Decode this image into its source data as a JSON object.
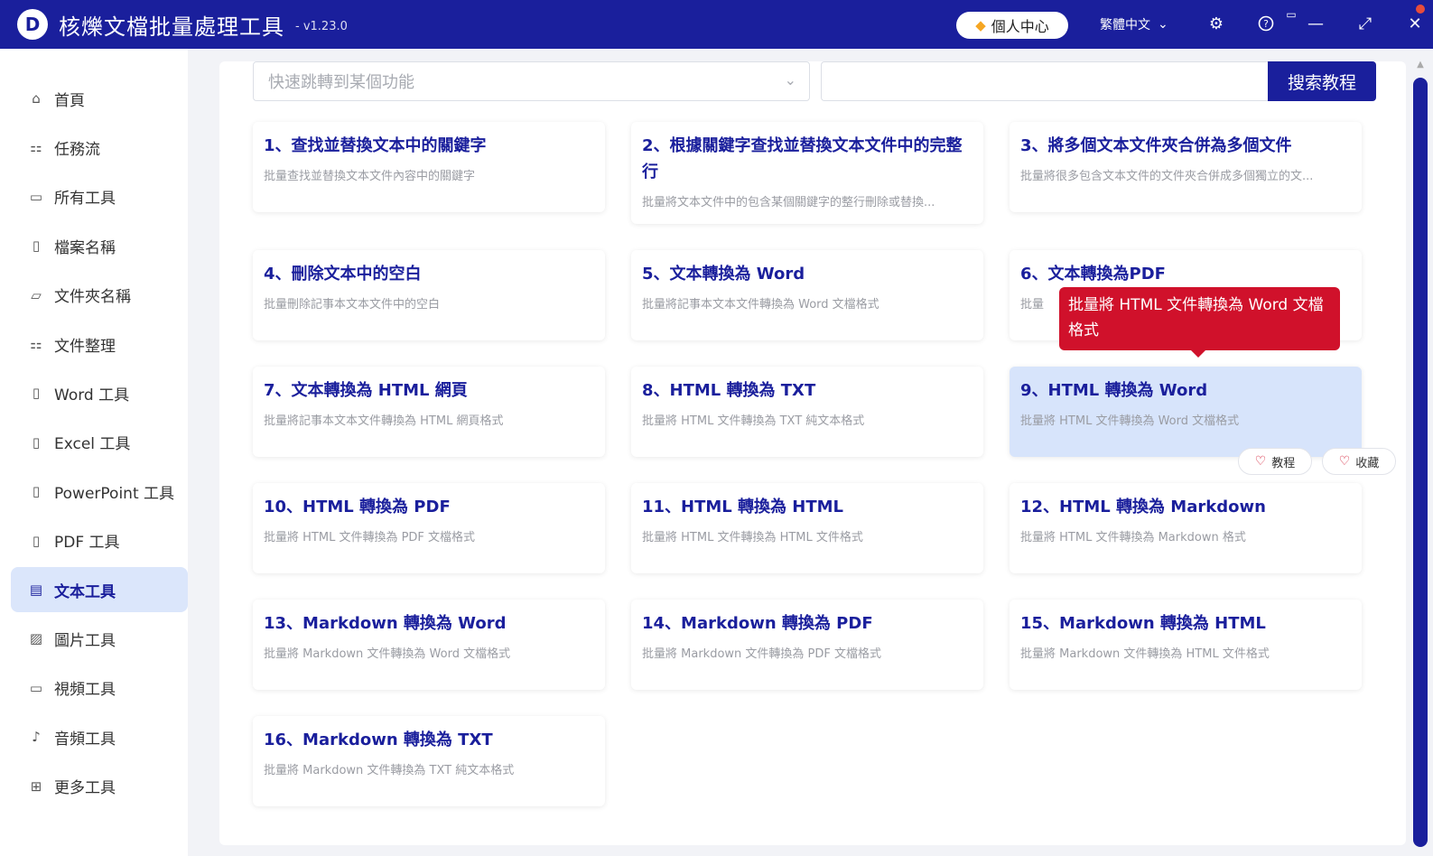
{
  "app": {
    "logo_letter": "D",
    "title": "核爍文檔批量處理工具",
    "version": "- v1.23.0",
    "user_center": "個人中心",
    "language": "繁體中文"
  },
  "sidebar": {
    "items": [
      {
        "label": "首頁",
        "icon": "⌂",
        "icon_name": "home-icon"
      },
      {
        "label": "任務流",
        "icon": "⚏",
        "icon_name": "workflow-icon"
      },
      {
        "label": "所有工具",
        "icon": "▭",
        "icon_name": "monitor-icon"
      },
      {
        "label": "檔案名稱",
        "icon": "▯",
        "icon_name": "file-name-icon"
      },
      {
        "label": "文件夾名稱",
        "icon": "▱",
        "icon_name": "folder-icon"
      },
      {
        "label": "文件整理",
        "icon": "⚏",
        "icon_name": "organize-icon"
      },
      {
        "label": "Word 工具",
        "icon": "▯",
        "icon_name": "word-icon"
      },
      {
        "label": "Excel 工具",
        "icon": "▯",
        "icon_name": "excel-icon"
      },
      {
        "label": "PowerPoint 工具",
        "icon": "▯",
        "icon_name": "powerpoint-icon"
      },
      {
        "label": "PDF 工具",
        "icon": "▯",
        "icon_name": "pdf-icon"
      },
      {
        "label": "文本工具",
        "icon": "▤",
        "icon_name": "text-icon"
      },
      {
        "label": "圖片工具",
        "icon": "▨",
        "icon_name": "image-icon"
      },
      {
        "label": "視頻工具",
        "icon": "▭",
        "icon_name": "video-icon"
      },
      {
        "label": "音頻工具",
        "icon": "♪",
        "icon_name": "microphone-icon"
      },
      {
        "label": "更多工具",
        "icon": "⊞",
        "icon_name": "grid-icon"
      }
    ],
    "active_index": 10
  },
  "search": {
    "jump_placeholder": "快速跳轉到某個功能",
    "button": "搜索教程"
  },
  "cards": [
    {
      "title": "1、查找並替換文本中的關鍵字",
      "desc": "批量查找並替換文本文件內容中的關鍵字"
    },
    {
      "title": "2、根據關鍵字查找並替換文本文件中的完整行",
      "desc": "批量將文本文件中的包含某個關鍵字的整行刪除或替換..."
    },
    {
      "title": "3、將多個文本文件夾合併為多個文件",
      "desc": "批量將很多包含文本文件的文件夾合併成多個獨立的文..."
    },
    {
      "title": "4、刪除文本中的空白",
      "desc": "批量刪除記事本文本文件中的空白"
    },
    {
      "title": "5、文本轉換為 Word",
      "desc": "批量將記事本文本文件轉換為 Word 文檔格式"
    },
    {
      "title": "6、文本轉換為PDF",
      "desc": "批量"
    },
    {
      "title": "7、文本轉換為 HTML 網頁",
      "desc": "批量將記事本文本文件轉換為 HTML 網頁格式"
    },
    {
      "title": "8、HTML 轉換為 TXT",
      "desc": "批量將 HTML 文件轉換為 TXT 純文本格式"
    },
    {
      "title": "9、HTML 轉換為 Word",
      "desc": "批量將 HTML 文件轉換為 Word 文檔格式"
    },
    {
      "title": "10、HTML 轉換為 PDF",
      "desc": "批量將 HTML 文件轉換為 PDF 文檔格式"
    },
    {
      "title": "11、HTML 轉換為 HTML",
      "desc": "批量將 HTML 文件轉換為 HTML 文件格式"
    },
    {
      "title": "12、HTML 轉換為 Markdown",
      "desc": "批量將 HTML 文件轉換為 Markdown 格式"
    },
    {
      "title": "13、Markdown 轉換為 Word",
      "desc": "批量將 Markdown 文件轉換為 Word 文檔格式"
    },
    {
      "title": "14、Markdown 轉換為 PDF",
      "desc": "批量將 Markdown 文件轉換為 PDF 文檔格式"
    },
    {
      "title": "15、Markdown 轉換為 HTML",
      "desc": "批量將 Markdown 文件轉換為 HTML 文件格式"
    },
    {
      "title": "16、Markdown 轉換為 TXT",
      "desc": "批量將 Markdown 文件轉換為 TXT 純文本格式"
    }
  ],
  "tooltip": "批量將 HTML 文件轉換為 Word 文檔格式",
  "card_actions": {
    "tutorial": "教程",
    "favorite": "收藏"
  },
  "colors": {
    "brand": "#1a1f9c",
    "tooltip": "#d0112b",
    "hover_card": "#d7e4fb"
  }
}
